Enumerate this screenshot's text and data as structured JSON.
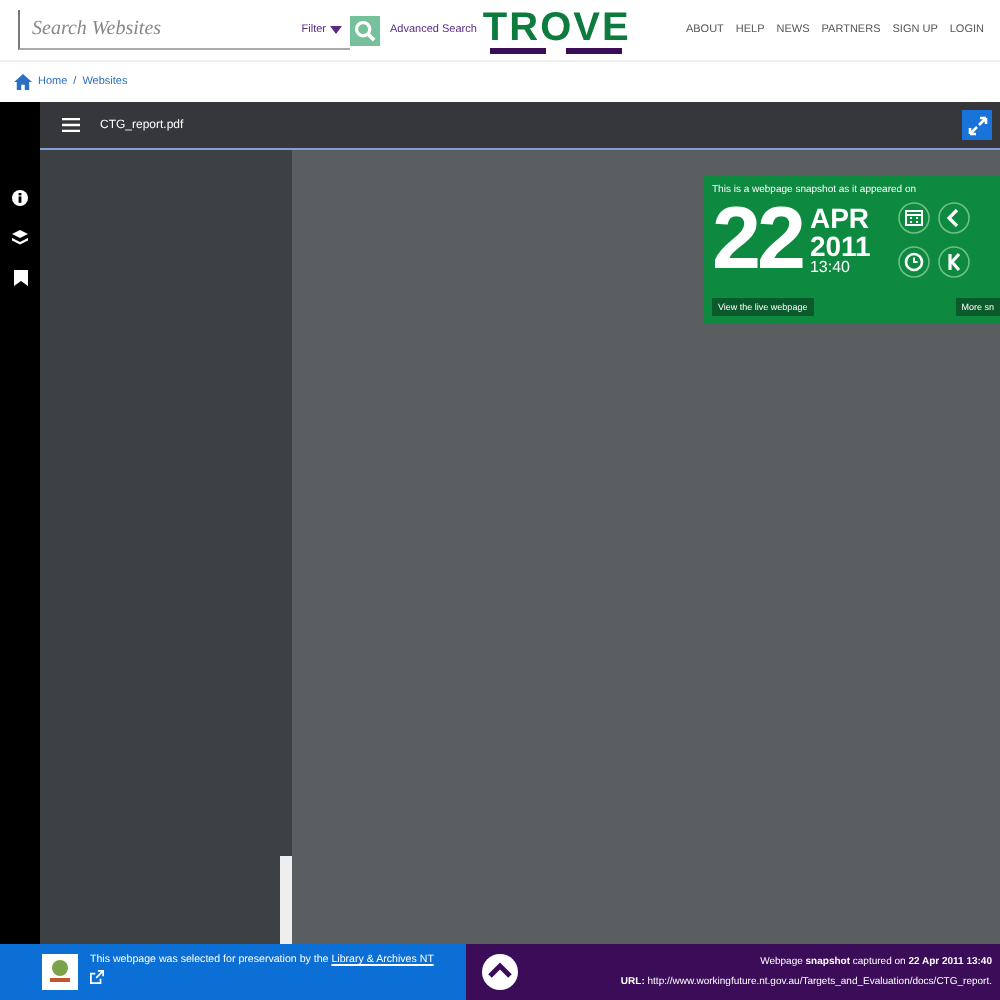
{
  "header": {
    "search": {
      "placeholder": "Search Websites"
    },
    "filter": "Filter",
    "advanced_search": "Advanced Search",
    "logo": "TROVE",
    "nav": [
      "ABOUT",
      "HELP",
      "NEWS",
      "PARTNERS",
      "SIGN UP",
      "LOGIN"
    ]
  },
  "breadcrumb": {
    "items": [
      "Home",
      "Websites"
    ],
    "separators": [
      "/"
    ]
  },
  "viewer": {
    "file_name": "CTG_report.pdf"
  },
  "snapshot": {
    "intro": "This is a webpage snapshot as it appeared on",
    "day": "22",
    "month": "APR",
    "year": "2011",
    "time": "13:40",
    "live_button": "View the live webpage",
    "more_button": "More sn"
  },
  "footer": {
    "preservation": "This webpage was selected for preservation by the ",
    "library_link": "Library & Archives NT",
    "captured_prefix": "Webpage ",
    "captured_bold": "snapshot",
    "captured_mid": " captured on ",
    "captured_date": "22 Apr 2011 13:40",
    "url_label": "URL:",
    "url": "http://www.workingfuture.nt.gov.au/Targets_and_Evaluation/docs/CTG_report."
  }
}
